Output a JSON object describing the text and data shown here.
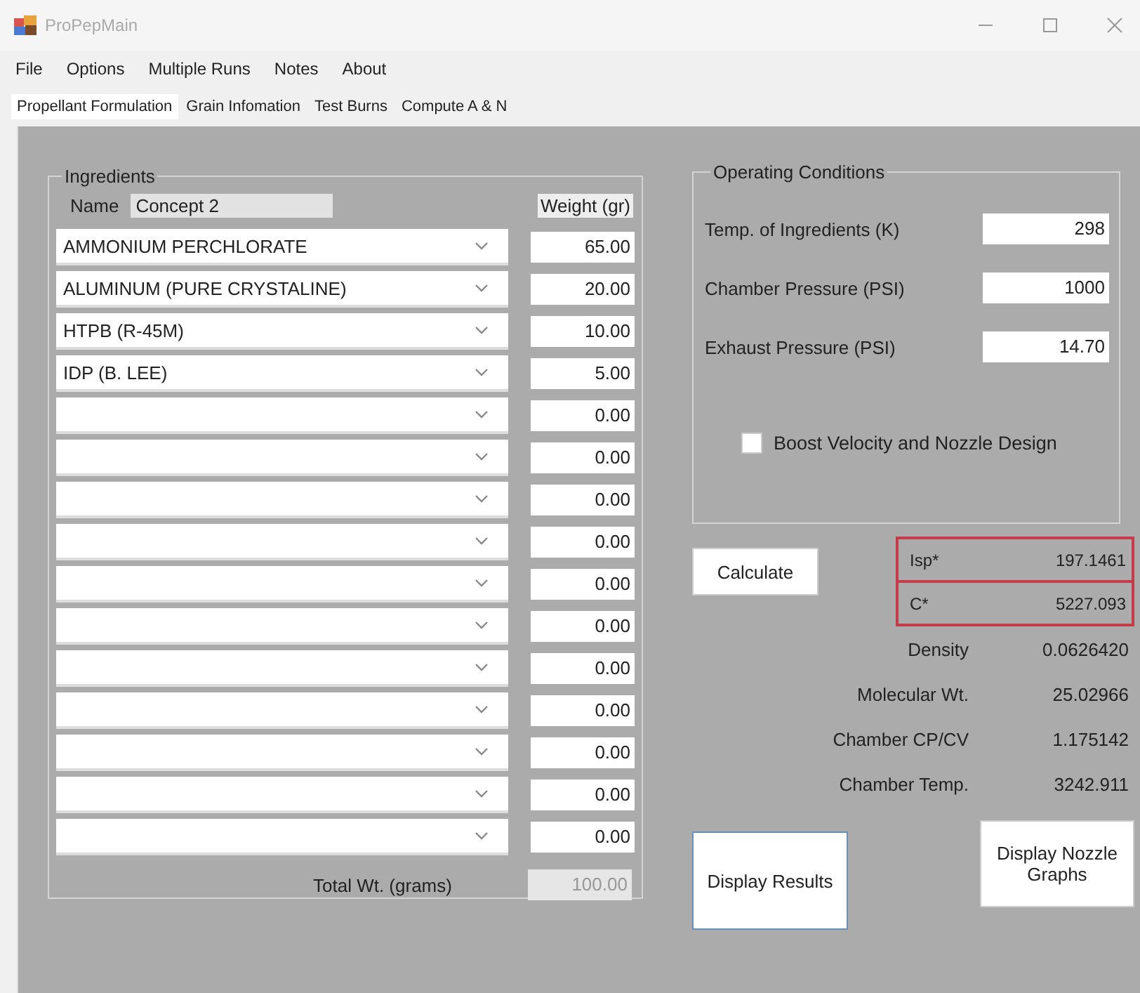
{
  "window": {
    "title": "ProPepMain"
  },
  "menu": [
    "File",
    "Options",
    "Multiple Runs",
    "Notes",
    "About"
  ],
  "tabs": [
    {
      "label": "Propellant Formulation",
      "selected": true
    },
    {
      "label": "Grain Infomation",
      "selected": false
    },
    {
      "label": "Test Burns",
      "selected": false
    },
    {
      "label": "Compute A & N",
      "selected": false
    }
  ],
  "ingredients": {
    "title": "Ingredients",
    "name_label": "Name",
    "name_value": "Concept 2",
    "weight_header": "Weight (gr)",
    "rows": [
      {
        "ingredient": "AMMONIUM PERCHLORATE",
        "weight": "65.00"
      },
      {
        "ingredient": "ALUMINUM (PURE CRYSTALINE)",
        "weight": "20.00"
      },
      {
        "ingredient": "HTPB (R-45M)",
        "weight": "10.00"
      },
      {
        "ingredient": "IDP (B. LEE)",
        "weight": "5.00"
      },
      {
        "ingredient": "",
        "weight": "0.00"
      },
      {
        "ingredient": "",
        "weight": "0.00"
      },
      {
        "ingredient": "",
        "weight": "0.00"
      },
      {
        "ingredient": "",
        "weight": "0.00"
      },
      {
        "ingredient": "",
        "weight": "0.00"
      },
      {
        "ingredient": "",
        "weight": "0.00"
      },
      {
        "ingredient": "",
        "weight": "0.00"
      },
      {
        "ingredient": "",
        "weight": "0.00"
      },
      {
        "ingredient": "",
        "weight": "0.00"
      },
      {
        "ingredient": "",
        "weight": "0.00"
      },
      {
        "ingredient": "",
        "weight": "0.00"
      }
    ],
    "total_label": "Total Wt. (grams)",
    "total_value": "100.00",
    "total_disabled": true
  },
  "operating_conditions": {
    "title": "Operating Conditions",
    "fields": [
      {
        "label": "Temp. of Ingredients (K)",
        "value": "298"
      },
      {
        "label": "Chamber Pressure (PSI)",
        "value": "1000"
      },
      {
        "label": "Exhaust Pressure (PSI)",
        "value": "14.70"
      }
    ],
    "checkbox": {
      "label": "Boost Velocity and Nozzle Design",
      "checked": false
    }
  },
  "calculate_button": "Calculate",
  "results": [
    {
      "label": "Isp*",
      "value": "197.1461",
      "highlighted": true
    },
    {
      "label": "C*",
      "value": "5227.093",
      "highlighted": true
    },
    {
      "label": "Density",
      "value": "0.0626420",
      "highlighted": false
    },
    {
      "label": "Molecular Wt.",
      "value": "25.02966",
      "highlighted": false
    },
    {
      "label": "Chamber CP/CV",
      "value": "1.175142",
      "highlighted": false
    },
    {
      "label": "Chamber Temp.",
      "value": "3242.911",
      "highlighted": false
    }
  ],
  "buttons": [
    {
      "label": "Display Results",
      "focused": true
    },
    {
      "label": "Display Nozzle Graphs",
      "focused": false
    }
  ]
}
